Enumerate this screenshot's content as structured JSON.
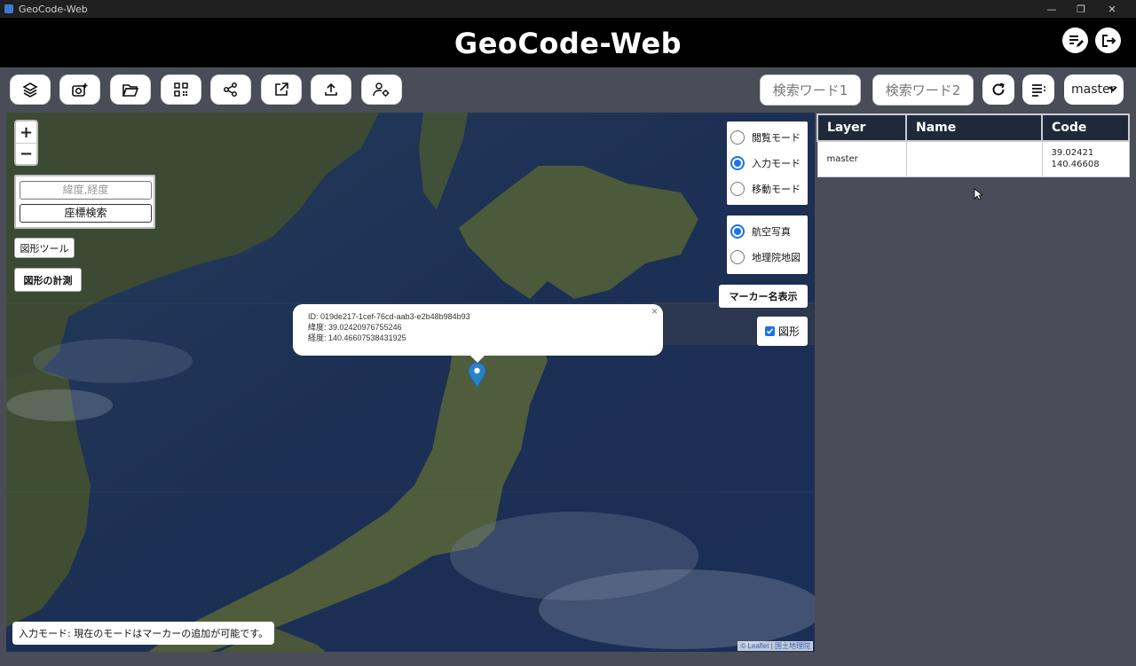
{
  "window": {
    "title": "GeoCode-Web"
  },
  "header": {
    "title": "GeoCode-Web"
  },
  "toolbar": {
    "search1_placeholder": "検索ワード1",
    "search2_placeholder": "検索ワード2",
    "layer_select_value": "master"
  },
  "map": {
    "zoom_in": "+",
    "zoom_out": "−",
    "coord_placeholder": "緯度,経度",
    "coord_search_label": "座標検索",
    "shape_tool_label": "図形ツール",
    "shape_measure_label": "図形の計測",
    "modes": [
      {
        "label": "閲覧モード",
        "selected": false
      },
      {
        "label": "入力モード",
        "selected": true
      },
      {
        "label": "移動モード",
        "selected": false
      }
    ],
    "basemaps": [
      {
        "label": "航空写真",
        "selected": true
      },
      {
        "label": "地理院地図",
        "selected": false
      }
    ],
    "marker_names_label": "マーカー名表示",
    "shape_checkbox_label": "図形",
    "popup": {
      "id_line": "ID: 019de217-1cef-76cd-aab3-e2b48b984b93",
      "lat_line": "緯度: 39.02420976755246",
      "lng_line": "経度: 140.46607538431925",
      "close": "×"
    },
    "status": "入力モード: 現在のモードはマーカーの追加が可能です。",
    "attribution_leaflet": "Leaflet",
    "attribution_separator": " | ",
    "attribution_source": "国土地理院"
  },
  "table": {
    "headers": [
      "Layer",
      "Name",
      "Code"
    ],
    "rows": [
      {
        "layer": "master",
        "name": "",
        "code_lat": "39.02421",
        "code_lng": "140.46608"
      }
    ]
  },
  "colors": {
    "accent": "#1a73e8",
    "header_bg": "#000000",
    "table_header_bg": "#20293a",
    "marker": "#2a81cb"
  }
}
